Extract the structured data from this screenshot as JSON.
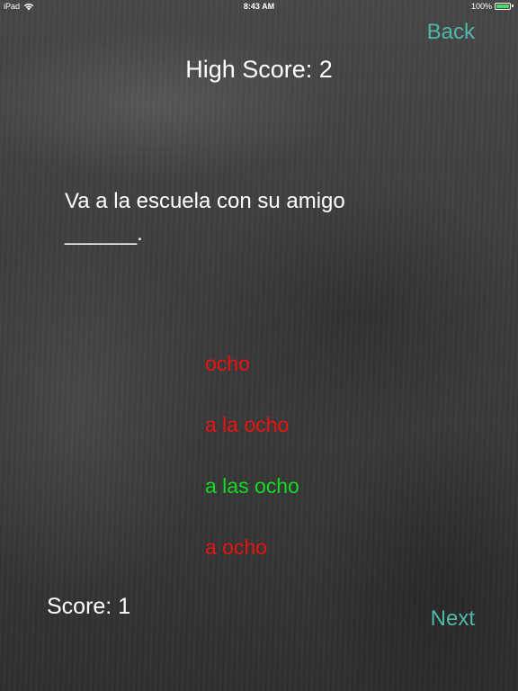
{
  "status_bar": {
    "device": "iPad",
    "time": "8:43 AM",
    "battery_text": "100%",
    "battery_level": 1.0,
    "icons": [
      "wifi-icon",
      "battery-icon"
    ]
  },
  "nav": {
    "back_label": "Back",
    "next_label": "Next"
  },
  "high_score": {
    "label": "High Score:  2"
  },
  "question": {
    "text": "Va a la escuela con su amigo ______."
  },
  "answers": [
    {
      "text": "ocho",
      "status": "wrong"
    },
    {
      "text": "a la ocho",
      "status": "wrong"
    },
    {
      "text": "a las ocho",
      "status": "correct"
    },
    {
      "text": "a ocho",
      "status": "wrong"
    }
  ],
  "score": {
    "label": "Score: 1"
  },
  "colors": {
    "nav_accent": "#4fb8a8",
    "wrong": "#ee1111",
    "correct": "#11dd22",
    "battery": "#4cd964",
    "text": "#ffffff"
  }
}
